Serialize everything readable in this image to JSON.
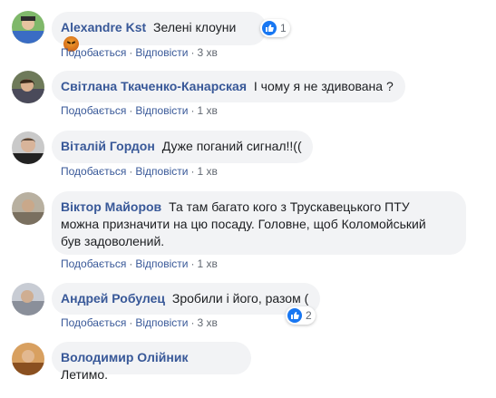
{
  "actions": {
    "like": "Подобається",
    "reply": "Відповісти",
    "separator": "·"
  },
  "comments": [
    {
      "author": "Alexandre Kst",
      "text": "Зелені клоуни",
      "emoji": "angry-face-emoji",
      "time": "3 хв",
      "reaction_icon": "like-icon",
      "reaction_count": "1"
    },
    {
      "author": "Світлана Ткаченко-Канарская",
      "text": "І чому я не здивована ?",
      "time": "1 хв"
    },
    {
      "author": "Віталій Гордон",
      "text": "Дуже поганий сигнал!!((",
      "time": "1 хв"
    },
    {
      "author": "Віктор Майоров",
      "text_lines": [
        "Та там багато кого з Трускавецького ПТУ",
        "можна призначити на цю посаду. Головне, щоб Коломойський",
        "був задоволений."
      ],
      "time": "1 хв"
    },
    {
      "author": "Андрей Робулец",
      "text": "Зробили і його, разом (",
      "time": "3 хв",
      "reaction_icon": "like-icon",
      "reaction_count": "2"
    },
    {
      "author": "Володимир Олійник",
      "text": "Летимо."
    }
  ],
  "colors": {
    "author": "#385898",
    "bubble": "#f2f3f5",
    "meta": "#606770",
    "like": "#1877f2"
  }
}
